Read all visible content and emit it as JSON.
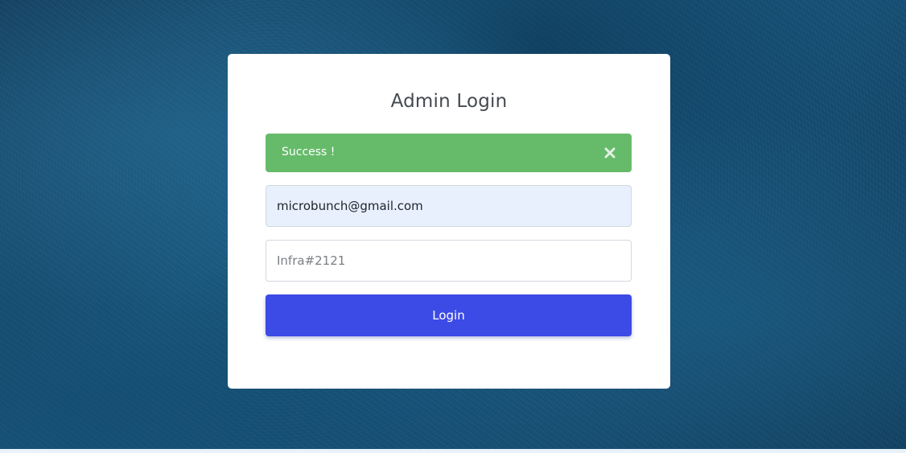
{
  "login": {
    "title": "Admin Login",
    "alert": {
      "message": "Success !",
      "close_icon": "close-icon"
    },
    "email": {
      "value": "microbunch@gmail.com"
    },
    "password": {
      "placeholder": "Infra#2121"
    },
    "submit_label": "Login"
  },
  "colors": {
    "alert_bg": "#66bb6a",
    "button_bg": "#3c4ae6",
    "email_bg": "#e8f0fe",
    "background": "#15527a"
  }
}
